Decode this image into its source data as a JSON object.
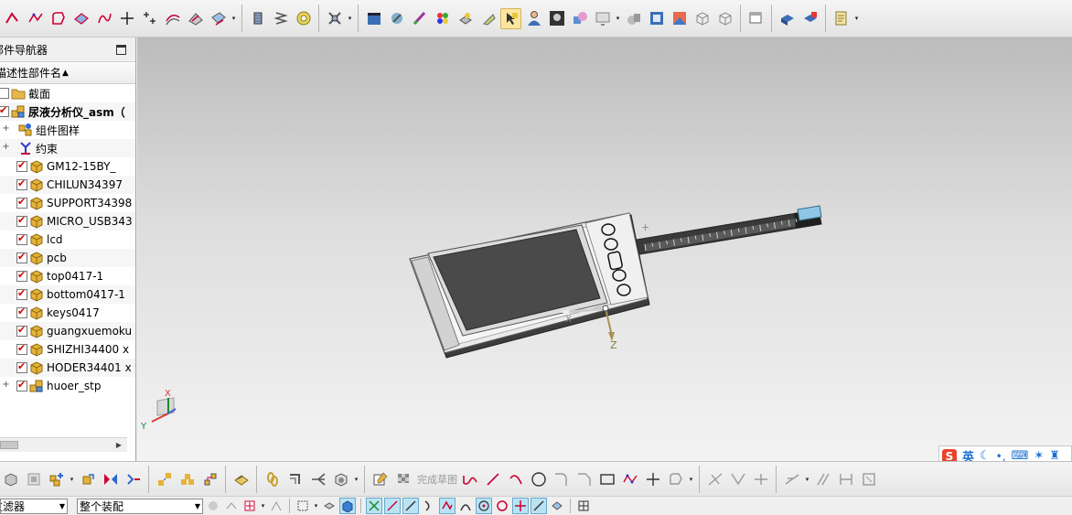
{
  "navigator": {
    "title": "部件导航器",
    "column_header": "描述性部件名",
    "items": [
      {
        "label": "截面",
        "checked": false,
        "icon": "folder-icon",
        "bold": false,
        "expandable": false
      },
      {
        "label": "尿液分析仪_asm（",
        "checked": true,
        "icon": "assembly-icon",
        "bold": true,
        "expandable": false
      },
      {
        "label": "组件图样",
        "checked": null,
        "icon": "pattern-icon",
        "bold": false,
        "expandable": true
      },
      {
        "label": "约束",
        "checked": null,
        "icon": "constraint-icon",
        "bold": false,
        "expandable": true
      },
      {
        "label": "GM12-15BY_",
        "checked": true,
        "icon": "part-icon",
        "bold": false,
        "expandable": false
      },
      {
        "label": "CHILUN34397",
        "checked": true,
        "icon": "part-icon",
        "bold": false,
        "expandable": false
      },
      {
        "label": "SUPPORT34398",
        "checked": true,
        "icon": "part-icon",
        "bold": false,
        "expandable": false
      },
      {
        "label": "MICRO_USB343",
        "checked": true,
        "icon": "part-icon",
        "bold": false,
        "expandable": false
      },
      {
        "label": "lcd",
        "checked": true,
        "icon": "part-icon",
        "bold": false,
        "expandable": false
      },
      {
        "label": "pcb",
        "checked": true,
        "icon": "part-icon",
        "bold": false,
        "expandable": false
      },
      {
        "label": "top0417-1",
        "checked": true,
        "icon": "part-icon",
        "bold": false,
        "expandable": false
      },
      {
        "label": "bottom0417-1",
        "checked": true,
        "icon": "part-icon",
        "bold": false,
        "expandable": false
      },
      {
        "label": "keys0417",
        "checked": true,
        "icon": "part-icon",
        "bold": false,
        "expandable": false
      },
      {
        "label": "guangxuemoku",
        "checked": true,
        "icon": "part-icon",
        "bold": false,
        "expandable": false
      },
      {
        "label": "SHIZHI34400 x",
        "checked": true,
        "icon": "part-icon",
        "bold": false,
        "expandable": false
      },
      {
        "label": "HODER34401 x",
        "checked": true,
        "icon": "part-icon",
        "bold": false,
        "expandable": false
      },
      {
        "label": "huoer_stp",
        "checked": true,
        "icon": "assembly-icon",
        "bold": false,
        "expandable": true
      }
    ]
  },
  "viewport": {
    "axis_labels": {
      "x": "X",
      "y": "Y",
      "z": "Z"
    }
  },
  "ime": {
    "mode_label": "英"
  },
  "bottom": {
    "finish_sketch_label": "完成草图",
    "filter_label": "过滤器",
    "scope_value": "整个装配"
  },
  "colors": {
    "checkmark": "#d40000",
    "folder": "#e8b84a",
    "part": "#e6b23a",
    "active_tool": "#fbe6a0",
    "viewport_top": "#bcbcbc",
    "viewport_bottom": "#f3f3f3"
  }
}
